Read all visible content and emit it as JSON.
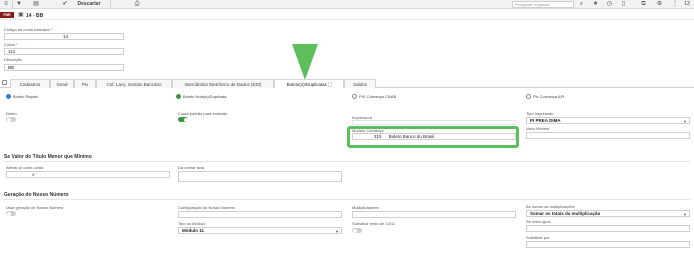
{
  "toolbar": {
    "discard_label": "Descartar",
    "search_placeholder": "Pesquisar registros",
    "page_count": "13"
  },
  "record": {
    "logo_text": "FBR",
    "title": "14 - BB"
  },
  "form": {
    "bank_code_label": "Código da conta bancária",
    "bank_code_value": "14",
    "account_label": "Conta",
    "account_value": "112",
    "description_label": "Descrição",
    "description_value": "BB"
  },
  "tabs": [
    {
      "label": "Cadastros"
    },
    {
      "label": "Geral"
    },
    {
      "label": "Pix"
    },
    {
      "label": "Cnf. Lanç. Extrato Bancário"
    },
    {
      "label": "Intercâmbio Eletrônico de Dados (EDI)"
    },
    {
      "label": "Boleto(s)/Duplicatas"
    },
    {
      "label": "Saldos"
    }
  ],
  "options": {
    "boleto_rapido": "Boleto Rápido",
    "boleto_duplicata": "Boleto Nota(s)/Duplicata",
    "pix_cnab": "PIX Cobrança CNAB",
    "pix_api": "Pix Cobrança API"
  },
  "boleto_section": {
    "direto_label": "Direto",
    "conta_padrao_label": "Conta padrão para emissão",
    "impressora_label": "Impressora",
    "modelo_label": "Modelo Cobrança",
    "modelo_code": "315",
    "modelo_value": "Boleto Banco do Brasil",
    "tipo_impressao_label": "Tipo Impressão",
    "tipo_impressao_value": "PI PREA DIMA",
    "valor_minimo_label": "Valor Mínimo"
  },
  "menor_section": {
    "title": "Se Valor do Título Menor que Mínimo",
    "alterar_label": "Alterar p/ outra conta",
    "da_cobrar_label": "Da cobrar taxa"
  },
  "nosso_numero": {
    "title": "Geração do Nosso Número",
    "usar_label": "Usar geração de Nosso Número",
    "config_label": "Configuração do Nosso Número",
    "tipo_label": "Tipo do Módulo",
    "tipo_value": "Módulo 11",
    "multiplicadores_label": "Multiplicadores",
    "substituir_label": "Substituir resto de 10/11",
    "ao_somar_label": "Ao somar as multiplicações",
    "ao_somar_value": "Somar os totais da multiplicação",
    "se_resto_label": "Se resto igual",
    "substituir_por_label": "Substituir por"
  },
  "colors": {
    "accent_green": "#5cbf5c",
    "radio_blue": "#2a7fd4",
    "logo_red": "#8b1a1a"
  }
}
